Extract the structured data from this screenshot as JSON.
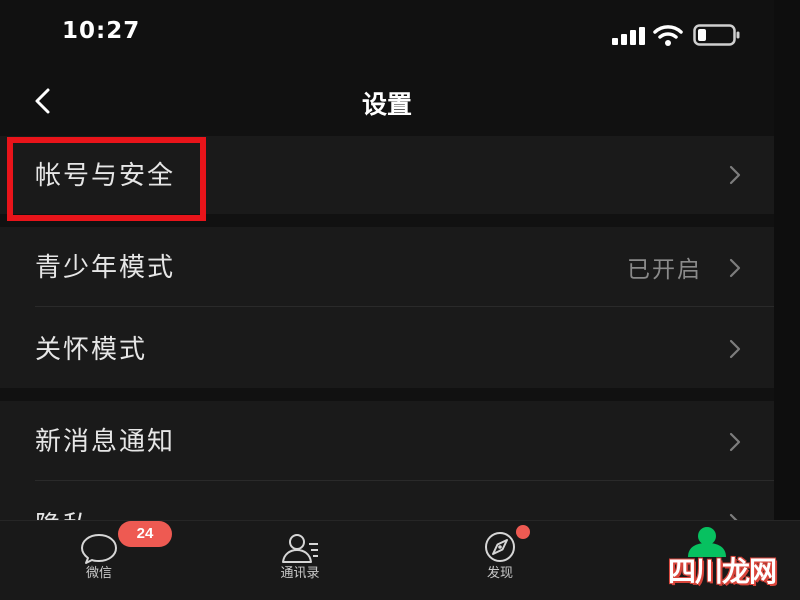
{
  "status_bar": {
    "time": "10:27",
    "icons": [
      "signal-icon",
      "wifi-icon",
      "battery-icon"
    ]
  },
  "nav": {
    "title": "设置",
    "back_icon": "chevron-left-icon"
  },
  "settings": {
    "account_security": {
      "label": "帐号与安全",
      "highlighted": true
    },
    "teen_mode": {
      "label": "青少年模式",
      "value": "已开启"
    },
    "care_mode": {
      "label": "关怀模式"
    },
    "new_message_notify": {
      "label": "新消息通知"
    },
    "privacy": {
      "label": "隐私"
    }
  },
  "tab_bar": {
    "chats": {
      "label": "微信",
      "badge": "24",
      "icon": "chat-bubble-icon"
    },
    "contacts": {
      "label": "通讯录",
      "icon": "contacts-icon"
    },
    "discover": {
      "label": "发现",
      "icon": "compass-icon",
      "dot": true
    },
    "me": {
      "icon": "person-icon"
    }
  },
  "watermark": "四川龙网",
  "colors": {
    "background": "#111111",
    "row_background": "#1a1a1a",
    "highlight": "#e8141a",
    "badge": "#ee5a52",
    "accent_green": "#07c160"
  }
}
